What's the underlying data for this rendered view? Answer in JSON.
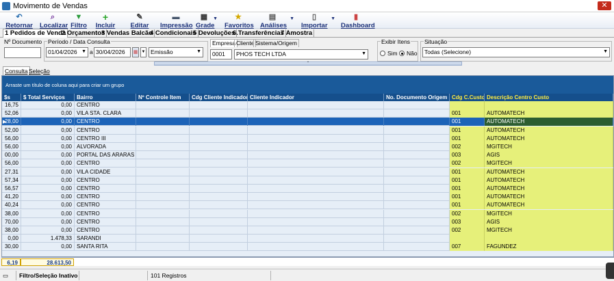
{
  "window": {
    "title": "Movimento de Vendas",
    "close_glyph": "✕"
  },
  "toolbar": [
    {
      "label": "Retornar",
      "icon": "↶",
      "color": "#2a6fb0"
    },
    {
      "label": "Localizar",
      "icon": "🔍",
      "color": "#7a3ea0"
    },
    {
      "label": "Filtro",
      "icon": "▼",
      "color": "#2a9a3a"
    },
    {
      "label": "Incluir",
      "icon": "+",
      "color": "#2aa52a"
    },
    {
      "label": "Editar",
      "icon": "✎",
      "color": "#333"
    },
    {
      "label": "Impressão",
      "icon": "▬",
      "color": "#44546a"
    },
    {
      "label": "Grade",
      "icon": "▦",
      "color": "#333"
    },
    {
      "label": "Favoritos",
      "icon": "★",
      "color": "#d4a800"
    },
    {
      "label": "Análises",
      "icon": "▤",
      "color": "#555"
    },
    {
      "label": "Importar",
      "icon": "▯",
      "color": "#555"
    },
    {
      "label": "Dashboard",
      "icon": "▮",
      "color": "#c44"
    }
  ],
  "main_tabs": [
    "1 Pedidos de Venda",
    "2 Orçamentos",
    "3 Vendas Balcão",
    "4 Condicionais",
    "5 Devoluções",
    "6.Transferências",
    "7 Amostra"
  ],
  "filters": {
    "documento_label": "Nº Documento",
    "documento_value": "",
    "periodo_label": "Período / Data Consulta",
    "date_from": "01/04/2026",
    "date_sep": "a",
    "date_to": "30/04/2026",
    "date_type": "Emissão",
    "inner_tabs": [
      "Empresa",
      "Cliente",
      "Sistema/Origem"
    ],
    "empresa_code": "0001",
    "empresa_name": "PHOS TECH LTDA",
    "exibir_label": "Exibir Itens",
    "exibir_sim": "Sim",
    "exibir_nao": "Não",
    "situacao_label": "Situação",
    "situacao_value": "Todas (Selecione)"
  },
  "sub_tabs": [
    "Consulta",
    "Seleção"
  ],
  "grid": {
    "group_hint": "Arraste um título de coluna aqui para criar um grupo",
    "columns": [
      "$s",
      "$ Total Serviços",
      "Bairro",
      "Nº Controle Item",
      "Cdg Cliente Indicador",
      "Cliente Indicador",
      "No. Documento Origem",
      "Cdg C.Custo",
      "Descrição Centro Custo"
    ],
    "rows": [
      [
        "16,75",
        "0,00",
        "CENTRO",
        "",
        "",
        "",
        "",
        "",
        ""
      ],
      [
        "52,06",
        "0,00",
        "VILA STA. CLARA",
        "",
        "",
        "",
        "",
        "001",
        "AUTOMATECH"
      ],
      [
        "28,00",
        "0,00",
        "CENTRO",
        "",
        "",
        "",
        "",
        "001",
        "AUTOMATECH"
      ],
      [
        "52,00",
        "0,00",
        "CENTRO",
        "",
        "",
        "",
        "",
        "001",
        "AUTOMATECH"
      ],
      [
        "56,00",
        "0,00",
        "CENTRO III",
        "",
        "",
        "",
        "",
        "001",
        "AUTOMATECH"
      ],
      [
        "56,00",
        "0,00",
        "ALVORADA",
        "",
        "",
        "",
        "",
        "002",
        "MGITECH"
      ],
      [
        "00,00",
        "0,00",
        "PORTAL DAS ARARAS",
        "",
        "",
        "",
        "",
        "003",
        "AGIS"
      ],
      [
        "56,00",
        "0,00",
        "CENTRO",
        "",
        "",
        "",
        "",
        "002",
        "MGITECH"
      ],
      [
        "27,31",
        "0,00",
        "VILA CIDADE",
        "",
        "",
        "",
        "",
        "001",
        "AUTOMATECH"
      ],
      [
        "57,34",
        "0,00",
        "CENTRO",
        "",
        "",
        "",
        "",
        "001",
        "AUTOMATECH"
      ],
      [
        "56,57",
        "0,00",
        "CENTRO",
        "",
        "",
        "",
        "",
        "001",
        "AUTOMATECH"
      ],
      [
        "41,20",
        "0,00",
        "CENTRO",
        "",
        "",
        "",
        "",
        "001",
        "AUTOMATECH"
      ],
      [
        "40,24",
        "0,00",
        "CENTRO",
        "",
        "",
        "",
        "",
        "001",
        "AUTOMATECH"
      ],
      [
        "38,00",
        "0,00",
        "CENTRO",
        "",
        "",
        "",
        "",
        "002",
        "MGITECH"
      ],
      [
        "70,00",
        "0,00",
        "CENTRO",
        "",
        "",
        "",
        "",
        "003",
        "AGIS"
      ],
      [
        "38,00",
        "0,00",
        "CENTRO",
        "",
        "",
        "",
        "",
        "002",
        "MGITECH"
      ],
      [
        "0,00",
        "1.478,33",
        "SARANDI",
        "",
        "",
        "",
        "",
        "",
        ""
      ],
      [
        "30,00",
        "0,00",
        "SANTA RITA",
        "",
        "",
        "",
        "",
        "007",
        "FAGUNDEZ"
      ]
    ],
    "selected_row": 2,
    "totals": [
      "6,19",
      "28.613,50"
    ]
  },
  "status": {
    "filter": "Filtro/Seleção Inativo",
    "count": "101 Registros"
  },
  "colors": {
    "header_bg": "#154f8c",
    "selection": "#1c63b8",
    "highlight_cols": "#e6f07a"
  }
}
